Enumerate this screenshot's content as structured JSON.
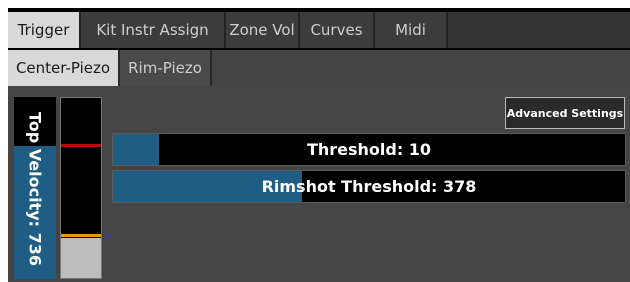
{
  "tabs": [
    "Trigger",
    "Kit Instr Assign",
    "Zone Vol",
    "Curves",
    "Midi"
  ],
  "subtabs": [
    "Center-Piezo",
    "Rim-Piezo"
  ],
  "top_velocity": {
    "label": "Top Velocity: 736",
    "level": 0.73
  },
  "meter": {
    "fill_level": 0.22,
    "marker_red": 0.73,
    "marker_yellow": 0.23
  },
  "advanced_settings_label": "Advanced Settings",
  "threshold": {
    "label": "Threshold: 10",
    "level": 0.09
  },
  "rimshot_threshold": {
    "label": "Rimshot Threshold: 378",
    "level": 0.37
  },
  "colors": {
    "accent_blue": "#1f5d85",
    "marker_red": "#b01010",
    "marker_yellow": "#e0a000",
    "meter_fill": "#bdbdbd"
  }
}
